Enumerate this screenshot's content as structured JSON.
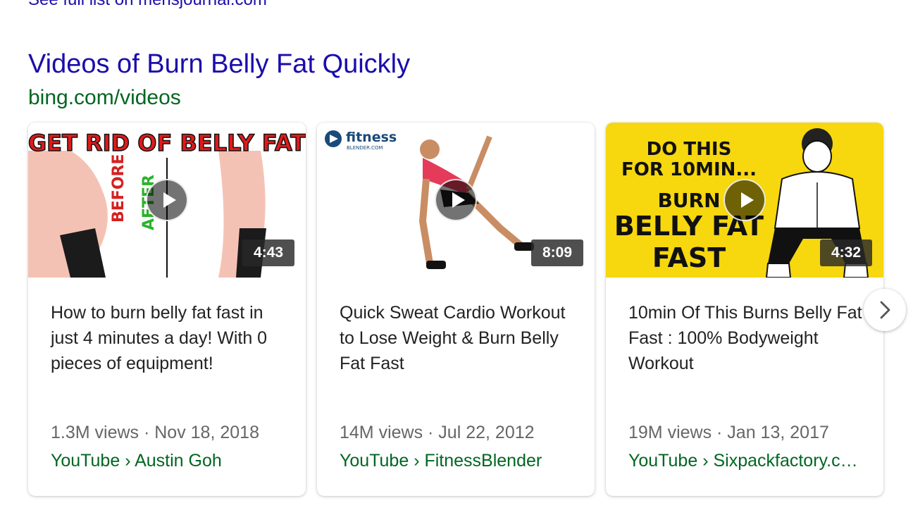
{
  "previous_section": {
    "link_text": "See full list on mensjournal.com"
  },
  "section": {
    "title": "Videos of Burn Belly Fat Quickly",
    "url": "bing.com/videos"
  },
  "videos": [
    {
      "thumbnail_text": {
        "headline": "GET RID OF BELLY FAT",
        "before": "BEFORE",
        "after": "AFTER"
      },
      "duration": "4:43",
      "title": "How to burn belly fat fast in just 4 minutes a day! With 0 pieces of equipment!",
      "meta": "1.3M views · Nov 18, 2018",
      "source": "YouTube › Austin Goh"
    },
    {
      "thumbnail_text": {
        "brand": "fitness",
        "brand_sub": "BLENDER.COM"
      },
      "duration": "8:09",
      "title": "Quick Sweat Cardio Workout to Lose Weight & Burn Belly Fat Fast",
      "meta": "14M views · Jul 22, 2012",
      "source": "YouTube › FitnessBlender"
    },
    {
      "thumbnail_text": {
        "line1": "DO THIS",
        "line2": "FOR 10MIN...",
        "line3": "BURN",
        "line4": "BELLY FAT",
        "line5": "FAST"
      },
      "duration": "4:32",
      "title": "10min Of This Burns Belly Fat Fast : 100% Bodyweight Workout",
      "meta": "19M views · Jan 13, 2017",
      "source": "YouTube › Sixpackfactory.c…"
    }
  ],
  "icons": {
    "play": "play-icon",
    "next": "chevron-right-icon"
  },
  "colors": {
    "link": "#1a0dab",
    "url": "#006621",
    "meta": "#666666",
    "yellow_thumb": "#f7d70e"
  }
}
